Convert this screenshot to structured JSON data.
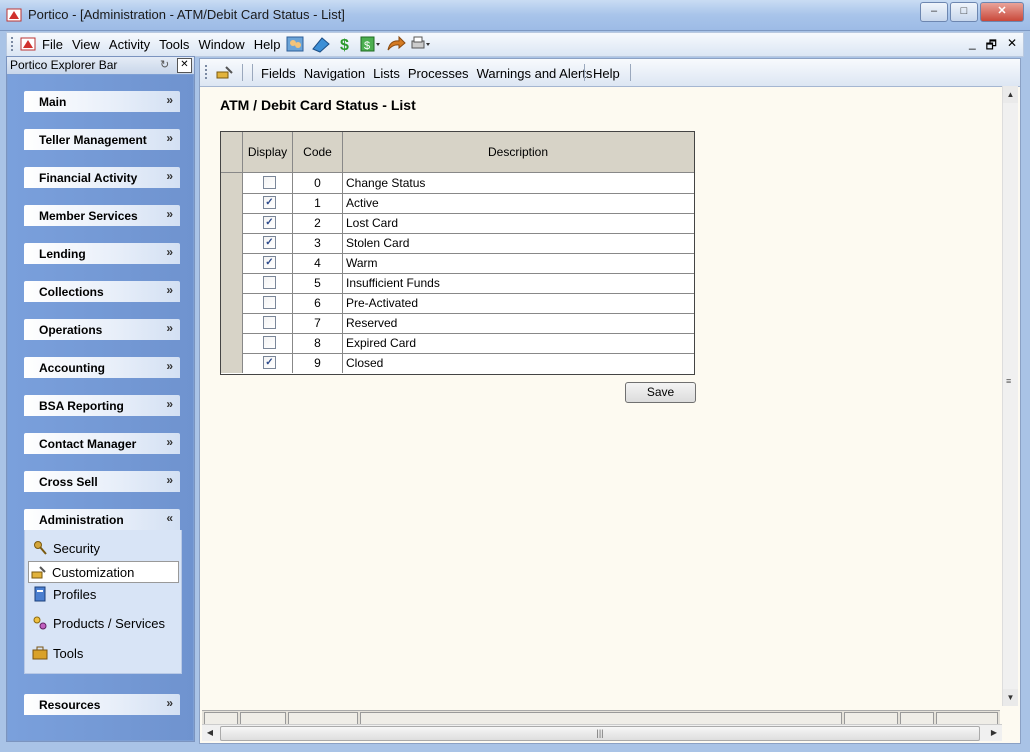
{
  "window": {
    "title": "Portico - [Administration - ATM/Debit Card Status - List]",
    "buttons": [
      "minimize",
      "maximize",
      "close"
    ]
  },
  "menubar": {
    "items": [
      "File",
      "View",
      "Activity",
      "Tools",
      "Window",
      "Help"
    ],
    "mdi_controls": [
      "_",
      "🗗",
      "✕"
    ]
  },
  "explorer": {
    "header": "Portico Explorer Bar",
    "groups": [
      {
        "label": "Main"
      },
      {
        "label": "Teller Management"
      },
      {
        "label": "Financial Activity"
      },
      {
        "label": "Member Services"
      },
      {
        "label": "Lending"
      },
      {
        "label": "Collections"
      },
      {
        "label": "Operations"
      },
      {
        "label": "Accounting"
      },
      {
        "label": "BSA Reporting"
      },
      {
        "label": "Contact Manager"
      },
      {
        "label": "Cross Sell"
      },
      {
        "label": "Administration"
      },
      {
        "label": "Resources"
      }
    ],
    "admin_items": [
      {
        "label": "Security"
      },
      {
        "label": "Customization"
      },
      {
        "label": "Profiles"
      },
      {
        "label": "Products / Services"
      },
      {
        "label": "Tools"
      }
    ],
    "expand_glyph": "»",
    "collapse_glyph": "«"
  },
  "content_toolbar": {
    "items": [
      "Fields",
      "Navigation",
      "Lists",
      "Processes",
      "Warnings and Alerts"
    ],
    "help": "Help"
  },
  "page": {
    "title": "ATM / Debit Card Status - List",
    "columns": {
      "display": "Display",
      "code": "Code",
      "description": "Description"
    },
    "rows": [
      {
        "display": false,
        "code": "0",
        "description": "Change Status"
      },
      {
        "display": true,
        "code": "1",
        "description": "Active"
      },
      {
        "display": true,
        "code": "2",
        "description": "Lost Card"
      },
      {
        "display": true,
        "code": "3",
        "description": "Stolen Card"
      },
      {
        "display": true,
        "code": "4",
        "description": "Warm"
      },
      {
        "display": false,
        "code": "5",
        "description": "Insufficient Funds"
      },
      {
        "display": false,
        "code": "6",
        "description": "Pre-Activated"
      },
      {
        "display": false,
        "code": "7",
        "description": "Reserved"
      },
      {
        "display": false,
        "code": "8",
        "description": "Expired Card"
      },
      {
        "display": true,
        "code": "9",
        "description": "Closed"
      }
    ],
    "save_label": "Save"
  }
}
